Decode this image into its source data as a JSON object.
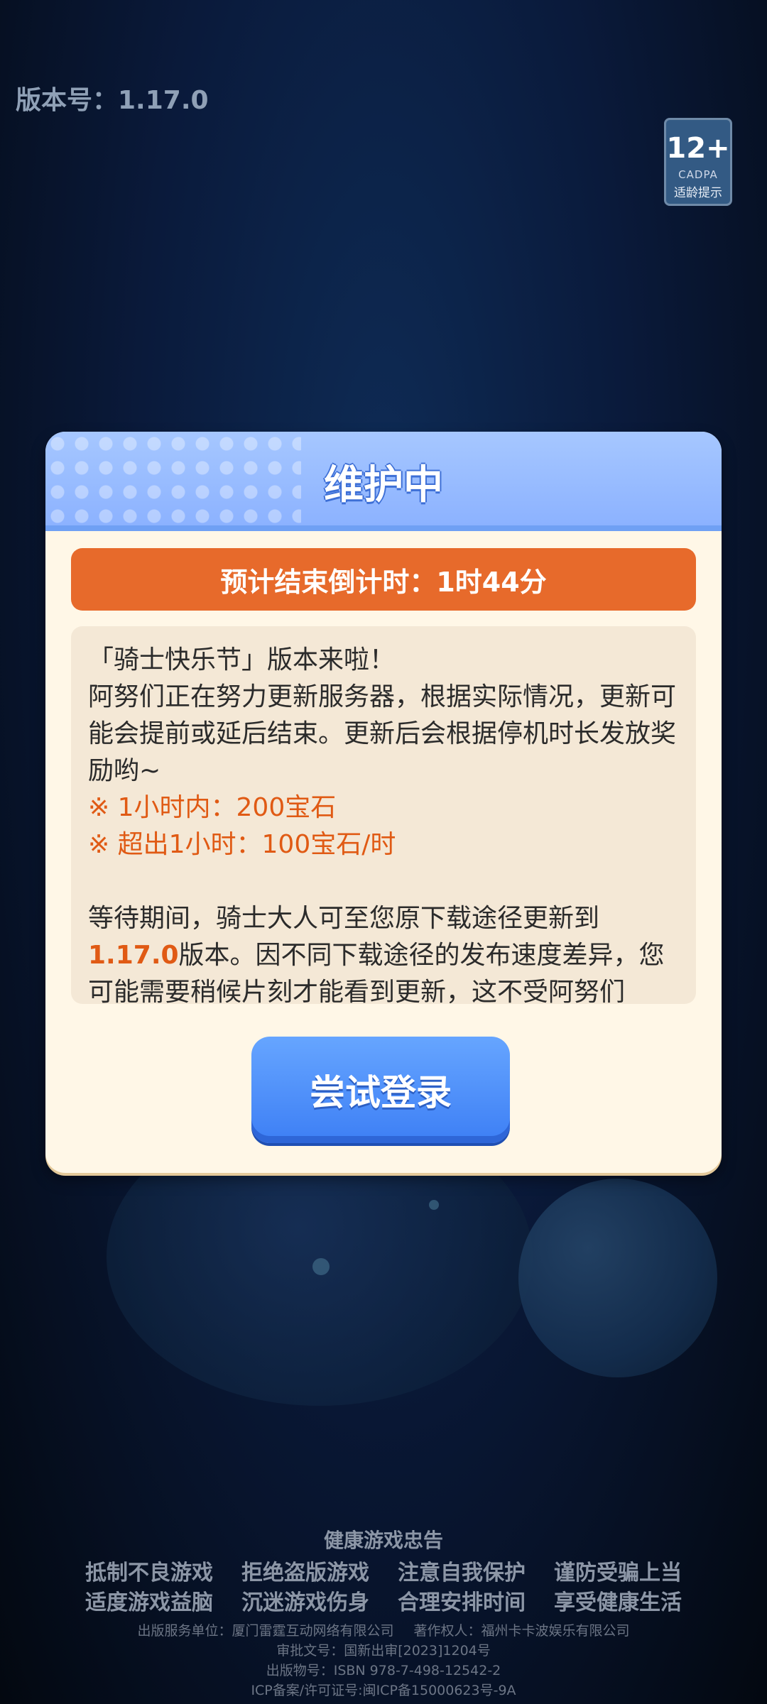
{
  "version_label": "版本号：1.17.0",
  "age_rating": {
    "number": "12+",
    "org": "CADPA",
    "tip": "适龄提示"
  },
  "dialog": {
    "title": "维护中",
    "countdown": "预计结束倒计时：1时44分",
    "notice": {
      "line1": "「骑士快乐节」版本来啦！",
      "paragraph1": "阿努们正在努力更新服务器，根据实际情况，更新可能会提前或延后结束。更新后会根据停机时长发放奖励哟~",
      "reward1": "※ 1小时内：200宝石",
      "reward2": "※ 超出1小时：100宝石/时",
      "paragraph2_a": "等待期间，骑士大人可至您原下载途径更新到",
      "paragraph2_version": "1.17.0",
      "paragraph2_b": "版本。因不同下载途径的发布速度差异，您可能需要稍候片刻才能看到更新，这不受阿努们"
    },
    "login_button": "尝试登录"
  },
  "footer": {
    "title": "健康游戏忠告",
    "row1": [
      "抵制不良游戏",
      "拒绝盗版游戏",
      "注意自我保护",
      "谨防受骗上当"
    ],
    "row2": [
      "适度游戏益脑",
      "沉迷游戏伤身",
      "合理安排时间",
      "享受健康生活"
    ],
    "publisher": "出版服务单位：厦门雷霆互动网络有限公司",
    "copyright": "著作权人：福州卡卡波娱乐有限公司",
    "approval": "审批文号：国新出审[2023]1204号",
    "isbn": "出版物号：ISBN 978-7-498-12542-2",
    "icp": "ICP备案/许可证号:闽ICP备15000623号-9A"
  }
}
